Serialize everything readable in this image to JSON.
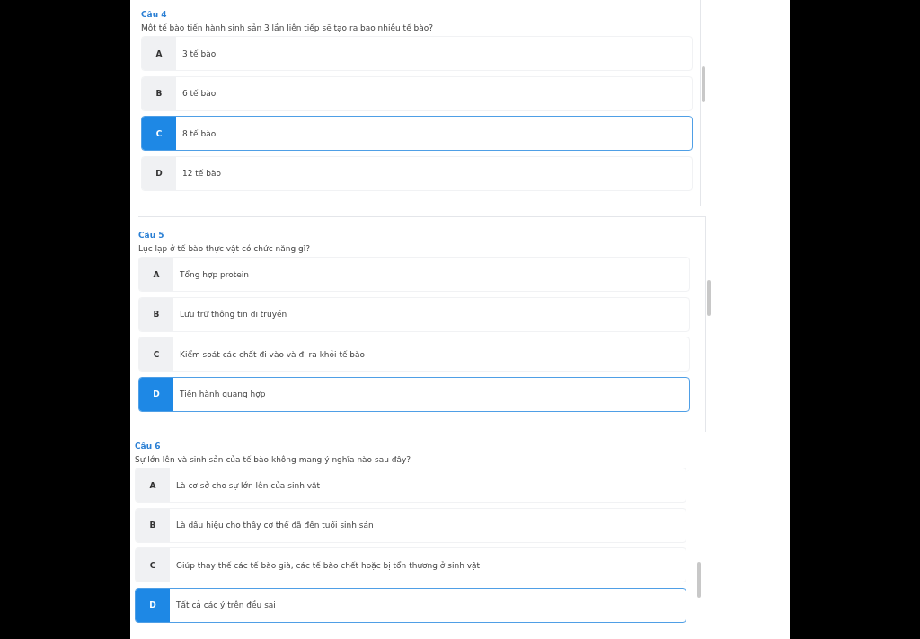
{
  "questions": [
    {
      "title": "Câu 4",
      "text": "Một tế bào tiến hành sinh sản 3 lần liên tiếp sẽ tạo ra bao nhiêu tế bào?",
      "options": [
        {
          "letter": "A",
          "text": "3 tế bào",
          "selected": false
        },
        {
          "letter": "B",
          "text": "6 tế bào",
          "selected": false
        },
        {
          "letter": "C",
          "text": "8 tế bào",
          "selected": true
        },
        {
          "letter": "D",
          "text": "12 tế bào",
          "selected": false
        }
      ]
    },
    {
      "title": "Câu 5",
      "text": "Lục lạp ở tế bào thực vật có chức năng gì?",
      "options": [
        {
          "letter": "A",
          "text": "Tổng hợp protein",
          "selected": false
        },
        {
          "letter": "B",
          "text": "Lưu trữ thông tin di truyền",
          "selected": false
        },
        {
          "letter": "C",
          "text": "Kiểm soát các chất đi vào và đi ra khỏi tế bào",
          "selected": false
        },
        {
          "letter": "D",
          "text": "Tiến hành quang hợp",
          "selected": true
        }
      ]
    },
    {
      "title": "Câu 6",
      "text": "Sự lớn lên và sinh sản của tế bào không mang ý nghĩa nào sau đây?",
      "options": [
        {
          "letter": "A",
          "text": "Là cơ sở cho sự lớn lên của sinh vật",
          "selected": false
        },
        {
          "letter": "B",
          "text": "Là dấu hiệu cho thấy cơ thể đã đến tuổi sinh sản",
          "selected": false
        },
        {
          "letter": "C",
          "text": "Giúp thay thế các tế bào già, các tế bào chết hoặc bị tổn thương ở sinh vật",
          "selected": false
        },
        {
          "letter": "D",
          "text": "Tất cả các ý trên đều sai",
          "selected": true
        }
      ]
    }
  ]
}
